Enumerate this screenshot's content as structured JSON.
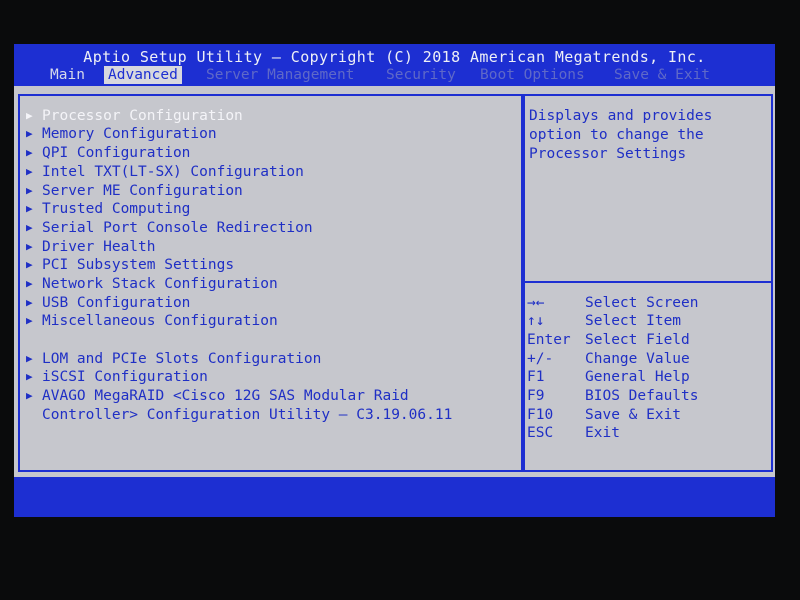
{
  "header": {
    "title": "Aptio Setup Utility – Copyright (C) 2018 American Megatrends, Inc.",
    "tabs": [
      {
        "label": "Main",
        "state": "normal"
      },
      {
        "label": "Advanced",
        "state": "active"
      },
      {
        "label": "Server Management",
        "state": "dim"
      },
      {
        "label": "Security",
        "state": "dim"
      },
      {
        "label": "Boot Options",
        "state": "dim"
      },
      {
        "label": "Save & Exit",
        "state": "dim"
      }
    ]
  },
  "menu": {
    "items": [
      {
        "label": "Processor Configuration",
        "selected": true
      },
      {
        "label": "Memory Configuration"
      },
      {
        "label": "QPI Configuration"
      },
      {
        "label": "Intel TXT(LT-SX) Configuration"
      },
      {
        "label": "Server ME Configuration"
      },
      {
        "label": "Trusted Computing"
      },
      {
        "label": "Serial Port Console Redirection"
      },
      {
        "label": "Driver Health"
      },
      {
        "label": "PCI Subsystem Settings"
      },
      {
        "label": "Network Stack Configuration"
      },
      {
        "label": "USB Configuration"
      },
      {
        "label": "Miscellaneous Configuration"
      },
      {
        "label": "LOM and PCIe Slots Configuration"
      },
      {
        "label": "iSCSI Configuration"
      },
      {
        "label": "AVAGO MegaRAID <Cisco 12G SAS Modular Raid"
      }
    ],
    "continuation": "Controller> Configuration Utility – C3.19.06.11"
  },
  "help": {
    "lines": [
      "Displays and provides",
      "option to change the",
      "Processor Settings"
    ]
  },
  "keys": [
    {
      "key": "→←",
      "desc": "Select Screen"
    },
    {
      "key": "↑↓",
      "desc": "Select Item"
    },
    {
      "key": "Enter",
      "desc": "Select Field"
    },
    {
      "key": "+/-",
      "desc": "Change Value"
    },
    {
      "key": "F1",
      "desc": "General Help"
    },
    {
      "key": "F9",
      "desc": "BIOS Defaults"
    },
    {
      "key": "F10",
      "desc": "Save & Exit"
    },
    {
      "key": "ESC",
      "desc": "Exit"
    }
  ],
  "colors": {
    "bios_blue": "#1d2fd2",
    "panel_gray": "#c6c7cd",
    "text_blue": "#1f2fc5",
    "selected_text": "#f4f4f8"
  }
}
